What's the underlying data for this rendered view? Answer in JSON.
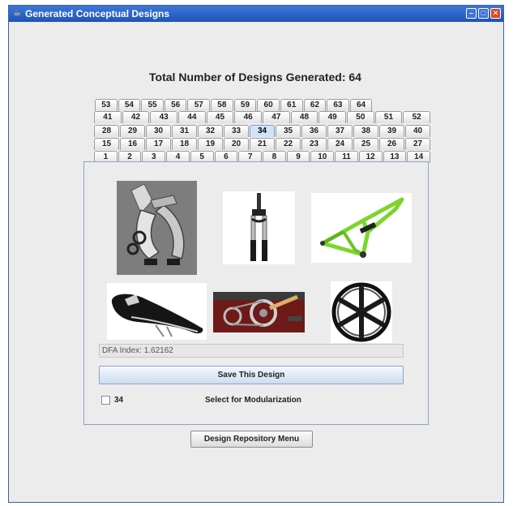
{
  "window": {
    "title": "Generated Conceptual Designs",
    "app_icon": "java-cup-icon"
  },
  "heading": "Total Number of Designs Generated: 64",
  "tabs": {
    "selected": "34",
    "rows": [
      [
        "53",
        "54",
        "55",
        "56",
        "57",
        "58",
        "59",
        "60",
        "61",
        "62",
        "63",
        "64"
      ],
      [
        "41",
        "42",
        "43",
        "44",
        "45",
        "46",
        "47",
        "48",
        "49",
        "50",
        "51",
        "52"
      ],
      [
        "28",
        "29",
        "30",
        "31",
        "32",
        "33",
        "34",
        "35",
        "36",
        "37",
        "38",
        "39",
        "40"
      ],
      [
        "15",
        "16",
        "17",
        "18",
        "19",
        "20",
        "21",
        "22",
        "23",
        "24",
        "25",
        "26",
        "27"
      ],
      [
        "1",
        "2",
        "3",
        "4",
        "5",
        "6",
        "7",
        "8",
        "9",
        "10",
        "11",
        "12",
        "13",
        "14"
      ]
    ]
  },
  "images": [
    {
      "name": "caliper-brake-image"
    },
    {
      "name": "suspension-fork-image"
    },
    {
      "name": "frame-image"
    },
    {
      "name": "saddle-image"
    },
    {
      "name": "drivetrain-image"
    },
    {
      "name": "wheel-image"
    }
  ],
  "dfa_index": "DFA Index: 1.62162",
  "save_button": "Save This Design",
  "checkbox": {
    "label": "34",
    "checked": false
  },
  "modularization_label": "Select for Modularization",
  "repository_button": "Design Repository Menu",
  "colors": {
    "titlebar": "#1f53b6",
    "frame_green": "#7bd62c",
    "panel_border": "#8aa3c6"
  }
}
